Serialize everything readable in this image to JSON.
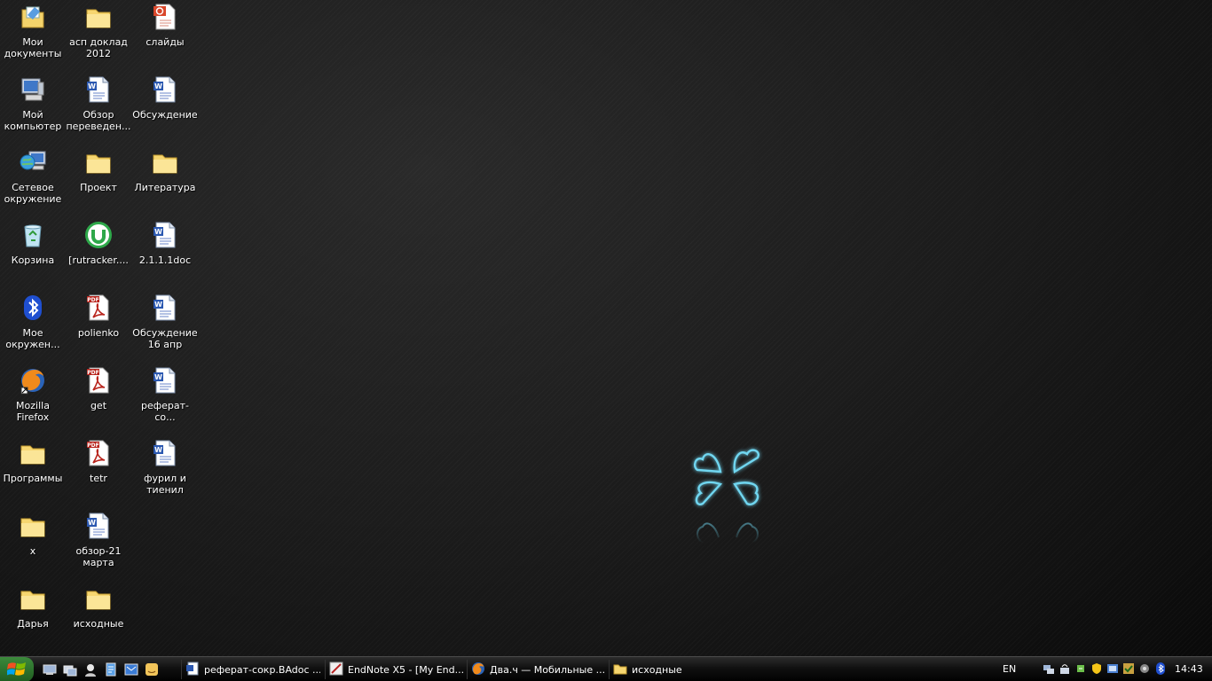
{
  "desktop": {
    "icons": [
      {
        "label": "Мои документы",
        "icon": "my-documents-icon"
      },
      {
        "label": "асп доклад 2012",
        "icon": "folder-icon"
      },
      {
        "label": "слайды",
        "icon": "powerpoint-file-icon"
      },
      {
        "label": "Мой компьютер",
        "icon": "my-computer-icon"
      },
      {
        "label": "Обзор переведен...",
        "icon": "word-document-icon"
      },
      {
        "label": "Обсуждение",
        "icon": "word-document-icon"
      },
      {
        "label": "Сетевое окружение",
        "icon": "network-places-icon"
      },
      {
        "label": "Проект",
        "icon": "folder-icon"
      },
      {
        "label": "Литература",
        "icon": "folder-icon"
      },
      {
        "label": "Корзина",
        "icon": "recycle-bin-icon"
      },
      {
        "label": "[rutracker....",
        "icon": "utorrent-icon"
      },
      {
        "label": "2.1.1.1doc",
        "icon": "word-document-icon"
      },
      {
        "label": "Мое окружен...",
        "icon": "bluetooth-icon"
      },
      {
        "label": "polienko",
        "icon": "pdf-file-icon"
      },
      {
        "label": "Обсуждение 16 апр",
        "icon": "word-document-icon"
      },
      {
        "label": "Mozilla Firefox",
        "icon": "firefox-icon"
      },
      {
        "label": "get",
        "icon": "pdf-file-icon"
      },
      {
        "label": "реферат-со...",
        "icon": "word-document-icon"
      },
      {
        "label": "Программы",
        "icon": "folder-icon"
      },
      {
        "label": "tetr",
        "icon": "pdf-file-icon"
      },
      {
        "label": "фурил и тиенил",
        "icon": "word-document-icon"
      },
      {
        "label": "x",
        "icon": "folder-icon"
      },
      {
        "label": "обзор-21 марта",
        "icon": "word-document-icon"
      },
      {
        "label": "Дарья",
        "icon": "folder-icon"
      },
      {
        "label": "исходные",
        "icon": "folder-icon"
      }
    ]
  },
  "taskbar": {
    "tasks": [
      {
        "label": "реферат-сокр.BAdoc ...",
        "icon": "word-document-icon"
      },
      {
        "label": "EndNote X5 - [My End...",
        "icon": "endnote-icon"
      },
      {
        "label": "Два.ч — Мобильные ...",
        "icon": "firefox-icon"
      },
      {
        "label": "исходные",
        "icon": "folder-icon"
      }
    ],
    "language": "EN",
    "clock": "14:43"
  },
  "colors": {
    "desktop_background": "#1d1d1d",
    "logo_glow": "#6fd6f0",
    "taskbar": "#0a0a0a",
    "start_button": "#2e7a2e",
    "label_text": "#ffffff"
  }
}
